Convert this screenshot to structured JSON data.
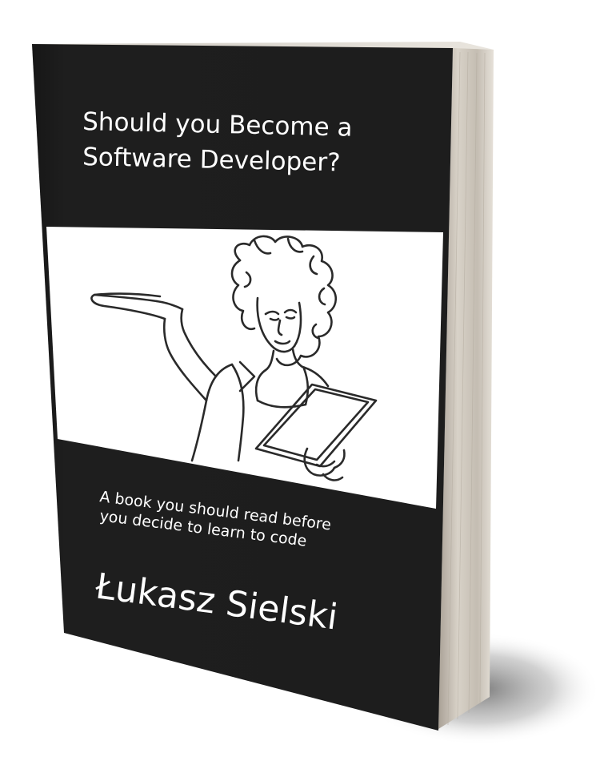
{
  "book": {
    "title_lines": [
      "Should you Become a",
      "Software Developer?"
    ],
    "subtitle_lines": [
      "A book you should read before",
      "you decide to learn to code"
    ],
    "author": "Łukasz Sielski"
  },
  "colors": {
    "cover": "#1e1e1e",
    "illustration_background": "#ffffff",
    "pages_edge": "#c9c2b8",
    "shadow": "#8a8a8a",
    "line_art": "#2a2a2a"
  }
}
